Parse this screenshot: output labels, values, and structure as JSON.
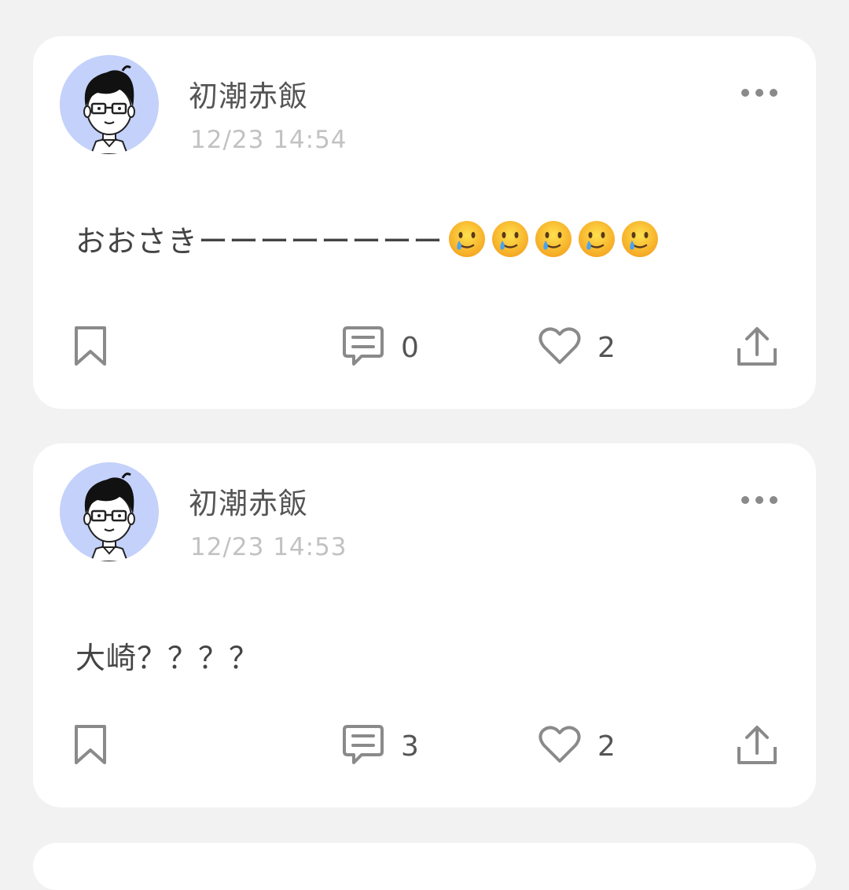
{
  "posts": [
    {
      "username": "初潮赤飯",
      "timestamp": "12/23 14:54",
      "text": "おおさきーーーーーーーー",
      "emoji": [
        "smiling-face-with-tear",
        "smiling-face-with-tear",
        "smiling-face-with-tear",
        "smiling-face-with-tear",
        "smiling-face-with-tear"
      ],
      "comments": "0",
      "likes": "2"
    },
    {
      "username": "初潮赤飯",
      "timestamp": "12/23 14:53",
      "text": "大崎？？？？",
      "emoji": [],
      "comments": "3",
      "likes": "2"
    }
  ],
  "icons": {
    "more": "more-horizontal-icon",
    "bookmark": "bookmark-icon",
    "comment": "comment-icon",
    "like": "heart-icon",
    "share": "share-icon"
  },
  "colors": {
    "background": "#f2f2f2",
    "card": "#ffffff",
    "avatar_bg": "#c3d1fb",
    "icon": "#8a8a8a",
    "timestamp": "#c2c2c2"
  }
}
